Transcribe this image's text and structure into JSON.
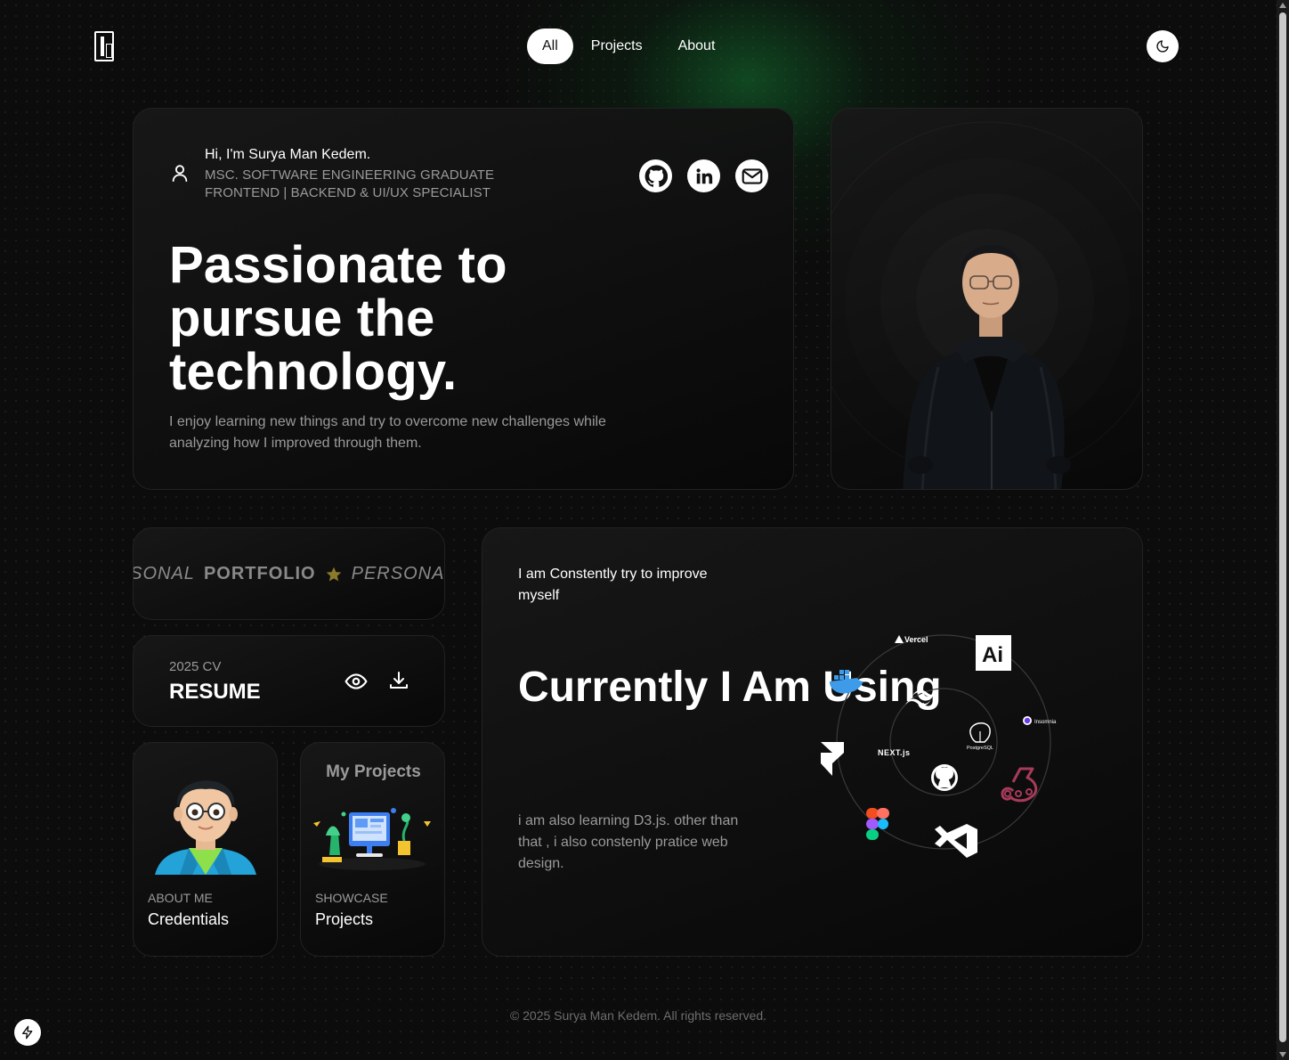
{
  "nav": {
    "items": [
      {
        "label": "All",
        "active": true
      },
      {
        "label": "Projects",
        "active": false
      },
      {
        "label": "About",
        "active": false
      }
    ]
  },
  "hero": {
    "greeting": "Hi, I'm Surya Man Kedem.",
    "subtitle_line1": "MSC. SOFTWARE ENGINEERING GRADUATE",
    "subtitle_line2": "FRONTEND | BACKEND & UI/UX SPECIALIST",
    "title": "Passionate to pursue the technology.",
    "description": "I enjoy learning new things and try to overcome new challenges while analyzing how I improved through them.",
    "socials": [
      "github-icon",
      "linkedin-icon",
      "mail-icon"
    ]
  },
  "marquee": {
    "italic_text": "PERSONAL",
    "bold_text": "PORTFOLIO",
    "separator_icon": "star-icon"
  },
  "resume": {
    "year": "2025 CV",
    "title": "RESUME"
  },
  "credentials": {
    "label": "ABOUT ME",
    "title": "Credentials"
  },
  "projects_card": {
    "heading": "My Projects",
    "label": "SHOWCASE",
    "title": "Projects"
  },
  "tools": {
    "intro": "I am Constently try to improve myself",
    "title": "Currently I Am Using",
    "description": "i am also learning D3.js. other than that , i also constenly pratice web design.",
    "logos": {
      "vercel": "Vercel",
      "illustrator": "Ai",
      "insomnia": "Insomnia",
      "nextjs": "NEXT.js",
      "postgres": "PostgreSQL"
    }
  },
  "footer": {
    "text": "© 2025 Surya Man Kedem. All rights reserved."
  },
  "colors": {
    "background": "#0c0c0c",
    "card": "#141414",
    "accent_green": "#147832",
    "muted_text": "#9a9a9a",
    "star": "#8a7a2a"
  }
}
